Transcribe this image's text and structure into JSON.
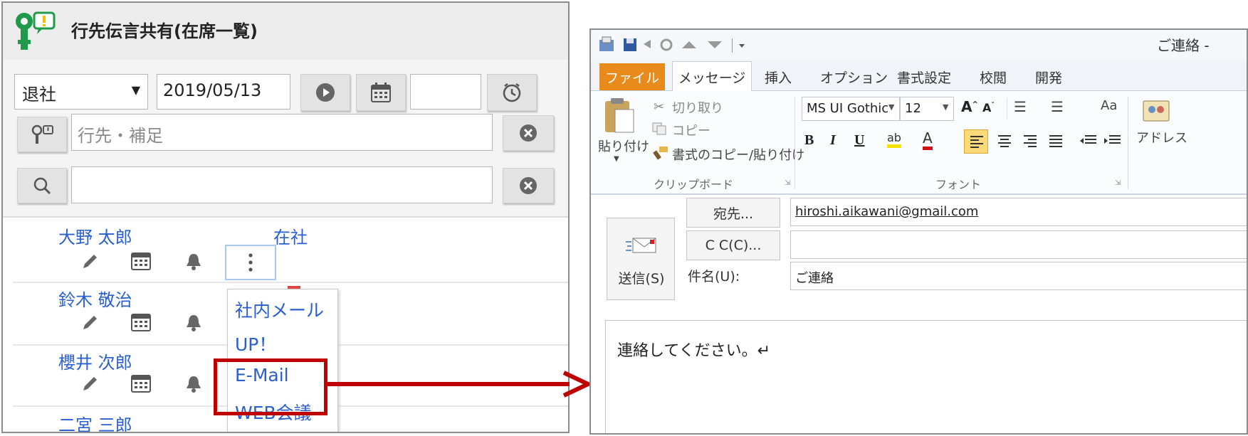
{
  "app": {
    "title": "行先伝言共有(在席一覧)"
  },
  "toolbar": {
    "status_value": "退社",
    "date_value": "2019/05/13",
    "time_value": "",
    "destination_placeholder": "行先・補足",
    "search_value": ""
  },
  "people": [
    {
      "name": "大野 太郎",
      "presence": "在社"
    },
    {
      "name": "鈴木 敬治",
      "presence": ""
    },
    {
      "name": "櫻井 次郎",
      "presence": ""
    },
    {
      "name": "二宮 三郎",
      "presence": ""
    }
  ],
  "context_menu": {
    "items": [
      "社内メール",
      "UP！",
      "E-Mail",
      "WEB会議"
    ],
    "highlighted": "E-Mail"
  },
  "mail_window": {
    "title": "ご連絡 - ",
    "tabs": [
      "ファイル",
      "メッセージ",
      "挿入",
      "オプション",
      "書式設定",
      "校閲",
      "開発"
    ],
    "clipboard": {
      "paste": "貼り付け",
      "cut": "切り取り",
      "copy": "コピー",
      "format_painter": "書式のコピー/貼り付け",
      "group_label": "クリップボード"
    },
    "font": {
      "family": "MS UI Gothic",
      "size": "12",
      "group_label": "フォント"
    },
    "address_book": "アドレス",
    "send_label": "送信(S)",
    "to_button": "宛先...",
    "cc_button": "C C(C)...",
    "to_value": "hiroshi.aikawani@gmail.com",
    "cc_value": "",
    "subject_label": "件名(U):",
    "subject_value": "ご連絡",
    "body_text": "連絡してください。↵"
  },
  "colors": {
    "link_blue": "#2a5fd0",
    "highlight_red": "#c00000",
    "file_tab_orange": "#e98a1c",
    "logo_green": "#1e9a4a",
    "logo_yellow": "#f2c200"
  }
}
